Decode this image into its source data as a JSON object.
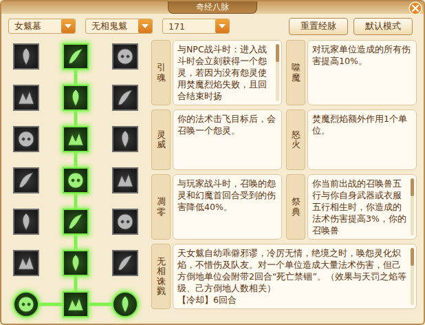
{
  "window": {
    "title": "奇经八脉"
  },
  "toolbar": {
    "dropdowns": [
      {
        "value": "女魃墓"
      },
      {
        "value": "无相鬼魃"
      },
      {
        "value": "171"
      }
    ],
    "buttons": [
      "重置经脉",
      "默认模式"
    ]
  },
  "nodes": [
    [
      {
        "kind": "square",
        "active": false
      },
      {
        "kind": "square",
        "active": true
      },
      {
        "kind": "square",
        "active": false
      }
    ],
    [
      {
        "kind": "square",
        "active": false
      },
      {
        "kind": "square",
        "active": true
      },
      {
        "kind": "square",
        "active": false
      }
    ],
    [
      {
        "kind": "square",
        "active": false
      },
      {
        "kind": "square",
        "active": true
      },
      {
        "kind": "square",
        "active": false
      }
    ],
    [
      {
        "kind": "square",
        "active": false
      },
      {
        "kind": "square",
        "active": true
      },
      {
        "kind": "square",
        "active": false
      }
    ],
    [
      {
        "kind": "square",
        "active": false
      },
      {
        "kind": "square",
        "active": true
      },
      {
        "kind": "square",
        "active": false
      }
    ],
    [
      {
        "kind": "square",
        "active": false
      },
      {
        "kind": "square",
        "active": true
      },
      {
        "kind": "square",
        "active": false
      }
    ],
    [
      {
        "kind": "circle",
        "active": true
      },
      {
        "kind": "square",
        "active": true
      },
      {
        "kind": "circle",
        "active": true
      }
    ]
  ],
  "links": [
    {
      "from": [
        0,
        1
      ],
      "to": [
        1,
        1
      ],
      "active": true
    },
    {
      "from": [
        1,
        1
      ],
      "to": [
        2,
        1
      ],
      "active": true
    },
    {
      "from": [
        2,
        1
      ],
      "to": [
        3,
        1
      ],
      "active": true
    },
    {
      "from": [
        3,
        1
      ],
      "to": [
        4,
        1
      ],
      "active": true
    },
    {
      "from": [
        4,
        1
      ],
      "to": [
        5,
        1
      ],
      "active": true
    },
    {
      "from": [
        5,
        1
      ],
      "to": [
        6,
        1
      ],
      "active": true
    },
    {
      "from": [
        6,
        0
      ],
      "to": [
        6,
        1
      ],
      "active": true
    },
    {
      "from": [
        6,
        1
      ],
      "to": [
        6,
        2
      ],
      "active": true
    }
  ],
  "skills": [
    {
      "kind": "half",
      "name": "引魂",
      "text": "与NPC战斗时：进入战斗时会立刻获得一个怨灵，若因为没有怨灵使用焚魔烈焰失败，且回合结束时扬",
      "scroll": true
    },
    {
      "kind": "half",
      "name": "噬魔",
      "text": "对玩家单位造成的所有伤害提高10%。",
      "scroll": false
    },
    {
      "kind": "half",
      "name": "灵威",
      "text": "你的法术击飞目标后，会召唤一个怨灵。",
      "scroll": false
    },
    {
      "kind": "half",
      "name": "怒火",
      "text": "焚魔烈焰额外作用1个单位。",
      "scroll": false
    },
    {
      "kind": "half",
      "name": "凋零",
      "text": "与玩家战斗时，召唤的怨灵和幻魔首回合受到的伤害降低40%。",
      "scroll": false
    },
    {
      "kind": "half",
      "name": "祭典",
      "text": "你当前出战的召唤兽五行与你自身武器或衣服五行相生时，你造成的法术伤害提高3%，你的召唤兽",
      "scroll": true
    },
    {
      "kind": "wide",
      "name": "无相诛戮",
      "text": "天女魃自幼乖僻邪谬，冷厉无情，绝境之时，唤怨灵化炽焰，不惜伤及队友。对一个单位造成大量法术伤害，但己方倒地单位会附带2回合“死亡禁锢”。（效果与天罚之焰等级、己方倒地人数相关）",
      "cooldown": "【冷却】6回合",
      "scroll": true
    }
  ]
}
